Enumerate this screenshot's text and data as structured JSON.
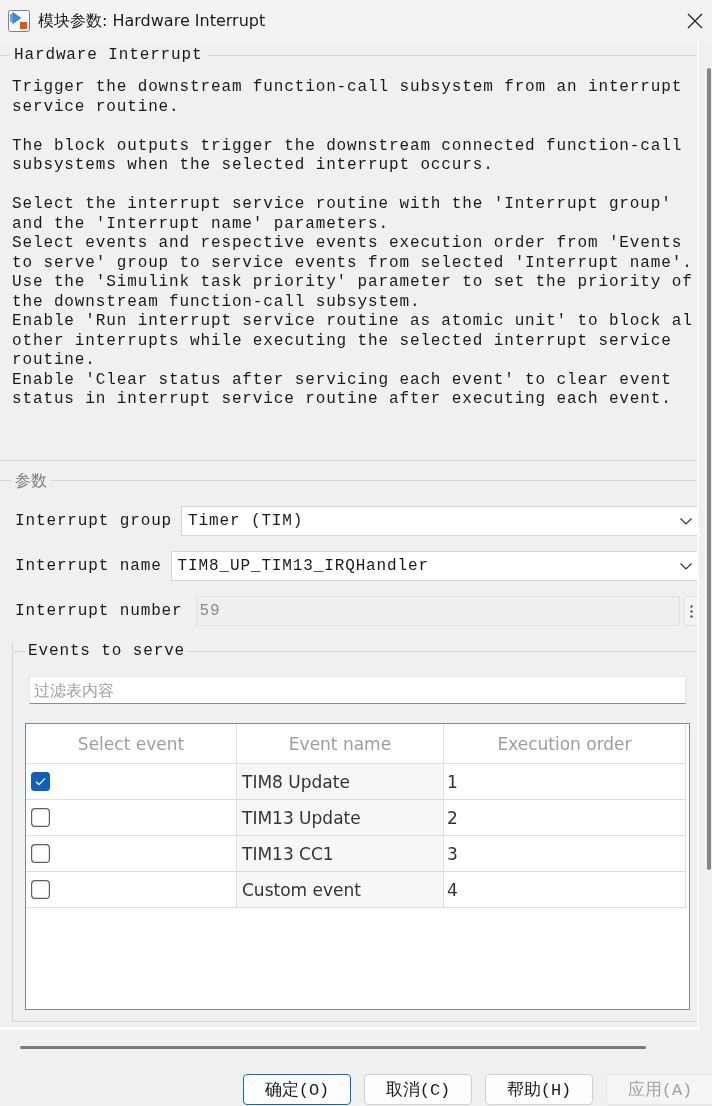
{
  "window": {
    "title": "模块参数: Hardware Interrupt"
  },
  "description": {
    "title": "Hardware Interrupt",
    "paragraphs": [
      [
        [
          "Trigger the downstream function-call subsystem from an interrupt",
          "service routine."
        ]
      ],
      [
        [
          "The block outputs trigger the downstream connected function-call",
          "subsystems when the selected interrupt occurs."
        ]
      ],
      [
        [
          "Select the interrupt service routine with the 'Interrupt group'",
          "and the 'Interrupt name' parameters."
        ],
        [
          "Select events and respective events execution order from 'Events",
          "to serve' group to service events from selected 'Interrupt name'."
        ],
        [
          "Use the 'Simulink task priority' parameter to set the priority of",
          "the downstream function-call subsystem."
        ],
        [
          "Enable 'Run interrupt service routine as atomic unit' to block al",
          "other interrupts while executing the selected interrupt service",
          "routine."
        ],
        [
          "Enable 'Clear status after servicing each event' to clear event",
          "status in interrupt service routine after executing each event."
        ]
      ]
    ]
  },
  "parameters": {
    "title": "参数",
    "fields": [
      {
        "kind": "dropdown",
        "label": "Interrupt group",
        "value": "Timer (TIM)",
        "disabled": false
      },
      {
        "kind": "dropdown",
        "label": "Interrupt name",
        "value": "TIM8_UP_TIM13_IRQHandler",
        "disabled": false
      },
      {
        "kind": "text",
        "label": "Interrupt number",
        "value": "59",
        "disabled": true
      }
    ]
  },
  "events": {
    "title": "Events to serve",
    "filter": {
      "placeholder": "过滤表内容"
    },
    "table": {
      "columns": [
        "Select event",
        "Event name",
        "Execution order"
      ],
      "rows": [
        {
          "checked": true,
          "event_name": "TIM8 Update",
          "execution_order": "1"
        },
        {
          "checked": false,
          "event_name": "TIM13 Update",
          "execution_order": "2"
        },
        {
          "checked": false,
          "event_name": "TIM13 CC1",
          "execution_order": "3"
        },
        {
          "checked": false,
          "event_name": "Custom event",
          "execution_order": "4"
        }
      ]
    }
  },
  "buttons": [
    {
      "label": "确定(O)",
      "focused": true,
      "disabled": false
    },
    {
      "label": "取消(C)",
      "focused": false,
      "disabled": false
    },
    {
      "label": "帮助(H)",
      "focused": false,
      "disabled": false
    },
    {
      "label": "应用(A)",
      "focused": false,
      "disabled": true
    }
  ]
}
